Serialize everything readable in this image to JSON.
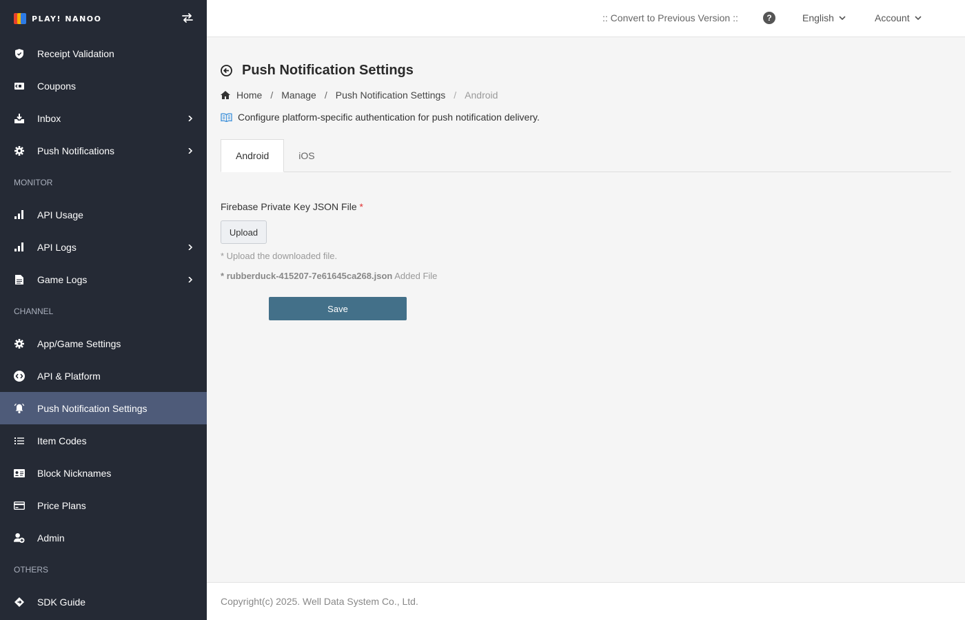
{
  "app": {
    "logo_text": "PLAY! NANOO"
  },
  "header": {
    "convert_label": ":: Convert to Previous Version ::",
    "help_glyph": "?",
    "language": "English",
    "account": "Account"
  },
  "sidebar": {
    "items_top": [
      {
        "label": "Receipt Validation",
        "icon": "shield-check-icon",
        "has_children": false
      },
      {
        "label": "Coupons",
        "icon": "ticket-icon",
        "has_children": false
      },
      {
        "label": "Inbox",
        "icon": "inbox-download-icon",
        "has_children": true
      },
      {
        "label": "Push Notifications",
        "icon": "gear-icon",
        "has_children": true
      }
    ],
    "section_monitor": "MONITOR",
    "items_monitor": [
      {
        "label": "API Usage",
        "icon": "bar-chart-icon",
        "has_children": false
      },
      {
        "label": "API Logs",
        "icon": "bar-chart-icon",
        "has_children": true
      },
      {
        "label": "Game Logs",
        "icon": "document-icon",
        "has_children": true
      }
    ],
    "section_channel": "CHANNEL",
    "items_channel": [
      {
        "label": "App/Game Settings",
        "icon": "gear-icon",
        "has_children": false
      },
      {
        "label": "API & Platform",
        "icon": "code-circle-icon",
        "has_children": false
      },
      {
        "label": "Push Notification Settings",
        "icon": "bell-ringing-icon",
        "has_children": false,
        "active": true
      },
      {
        "label": "Item Codes",
        "icon": "list-icon",
        "has_children": false
      },
      {
        "label": "Block Nicknames",
        "icon": "id-card-icon",
        "has_children": false
      },
      {
        "label": "Price Plans",
        "icon": "credit-card-icon",
        "has_children": false
      },
      {
        "label": "Admin",
        "icon": "user-add-icon",
        "has_children": false
      }
    ],
    "section_others": "OTHERS",
    "items_others": [
      {
        "label": "SDK Guide",
        "icon": "diamond-arrows-icon",
        "has_children": false
      }
    ]
  },
  "page": {
    "title": "Push Notification Settings",
    "breadcrumb": {
      "home": "Home",
      "sep": "/",
      "manage": "Manage",
      "section": "Push Notification Settings",
      "current": "Android"
    },
    "description": "Configure platform-specific authentication for push notification delivery.",
    "tabs": [
      "Android",
      "iOS"
    ],
    "active_tab": "Android",
    "form": {
      "field_label": "Firebase Private Key JSON File",
      "required_mark": "*",
      "upload_label": "Upload",
      "hint": "* Upload the downloaded file.",
      "file_prefix": "*",
      "file_name": "rubberduck-415207-7e61645ca268.json",
      "file_status": "Added File",
      "save_label": "Save"
    }
  },
  "footer": {
    "copyright": "Copyright(c) 2025. Well Data System Co., Ltd."
  },
  "colors": {
    "sidebar_bg": "#252a35",
    "sidebar_active": "#4e5b79",
    "save_button": "#437089",
    "required": "#e03131"
  }
}
